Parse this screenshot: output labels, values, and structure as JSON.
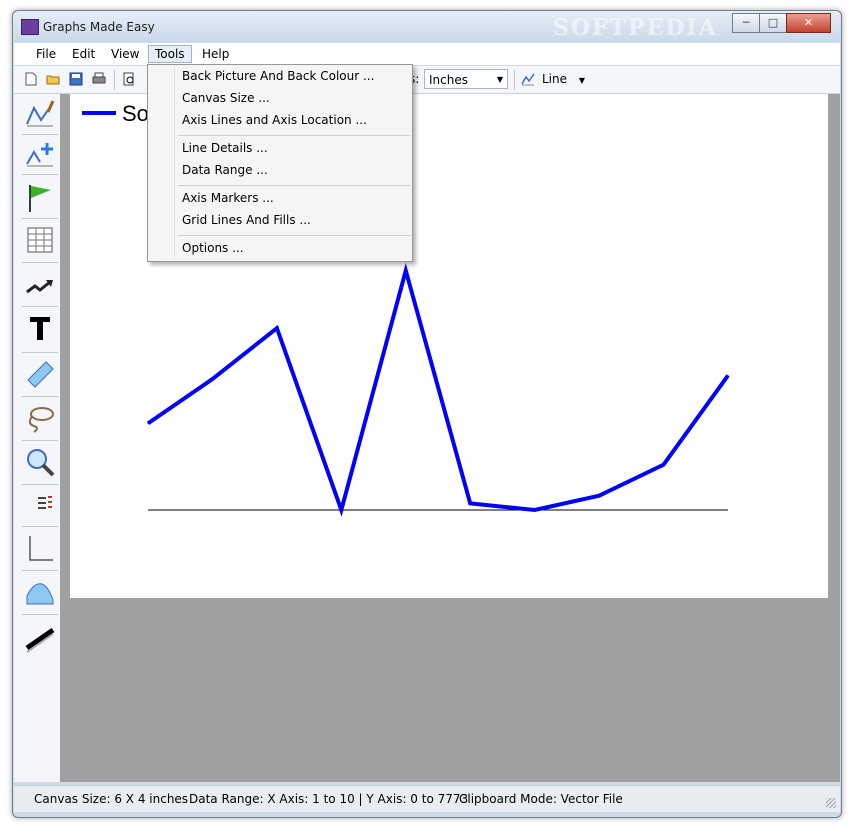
{
  "window": {
    "title": "Graphs Made Easy",
    "watermark": "SOFTPEDIA",
    "minimize_glyph": "─",
    "maximize_glyph": "□",
    "close_glyph": "✕"
  },
  "menu": [
    {
      "label": "File"
    },
    {
      "label": "Edit"
    },
    {
      "label": "View"
    },
    {
      "label": "Tools"
    },
    {
      "label": "Help"
    }
  ],
  "tools_menu": {
    "groups": [
      [
        "Back Picture And Back Colour ...",
        "Canvas Size ...",
        "Axis Lines and Axis Location ..."
      ],
      [
        "Line Details ...",
        "Data Range ..."
      ],
      [
        "Axis Markers ...",
        "Grid Lines And Fills ..."
      ],
      [
        "Options ..."
      ]
    ]
  },
  "toolbar": {
    "units_label_partial": "s:",
    "units_value": "Inches",
    "chart_type": "Line",
    "icons": [
      "new-icon",
      "open-icon",
      "save-icon",
      "print-icon",
      "print-preview-icon"
    ]
  },
  "sidebar": {
    "icons": [
      "draw-line-icon",
      "add-point-icon",
      "flag-icon",
      "grid-table-icon",
      "trend-arrow-icon",
      "text-tool-icon",
      "eraser-icon",
      "lasso-icon",
      "zoom-icon",
      "list-icon",
      "axis-icon",
      "area-fill-icon",
      "thick-line-icon"
    ]
  },
  "legend": {
    "label_partial": "So",
    "color": "#0000ff"
  },
  "chart_data": {
    "type": "line",
    "x": [
      1,
      2,
      3,
      4,
      5,
      6,
      7,
      8,
      9,
      10
    ],
    "series": [
      {
        "values": [
          1700,
          2570,
          3570,
          0,
          4700,
          130,
          0,
          280,
          890,
          2640
        ],
        "color": "#0000ff"
      }
    ],
    "ylim": [
      0,
      7773
    ],
    "xlim": [
      1,
      10
    ]
  },
  "status": {
    "canvas_size": "Canvas Size:  6 X 4  inches",
    "data_range": "Data Range:  X Axis: 1 to 10  |  Y Axis: 0 to  7773",
    "clipboard": "Clipboard Mode: Vector File"
  },
  "colors": {
    "canvas_bg": "#ffffff",
    "workspace_bg": "#a0a0a0",
    "line": "#0000ff"
  }
}
